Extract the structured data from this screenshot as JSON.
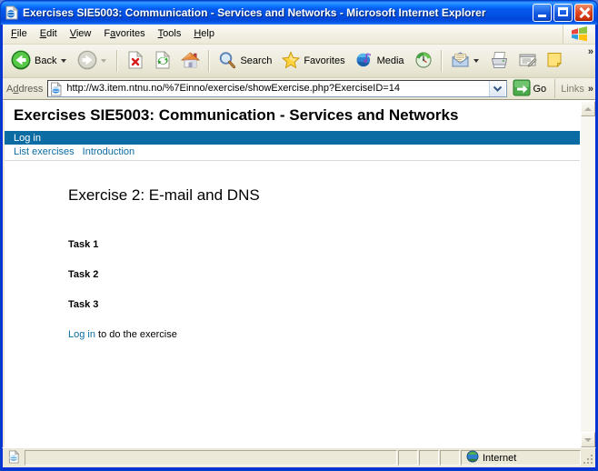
{
  "window": {
    "title": "Exercises SIE5003: Communication - Services and Networks - Microsoft Internet Explorer",
    "icon": "ie-document-icon",
    "buttons": {
      "minimize": "Minimize",
      "maximize": "Maximize",
      "close": "Close"
    }
  },
  "menubar": {
    "items": [
      {
        "label": "File",
        "accel": "F"
      },
      {
        "label": "Edit",
        "accel": "E"
      },
      {
        "label": "View",
        "accel": "V"
      },
      {
        "label": "Favorites",
        "accel": "a"
      },
      {
        "label": "Tools",
        "accel": "T"
      },
      {
        "label": "Help",
        "accel": "H"
      }
    ],
    "brand_icon": "windows-flag-icon"
  },
  "toolbar": {
    "back": {
      "label": "Back",
      "icon": "back-arrow-icon",
      "enabled": true
    },
    "forward": {
      "label": "",
      "icon": "forward-arrow-icon",
      "enabled": false
    },
    "stop": {
      "label": "",
      "icon": "stop-icon"
    },
    "refresh": {
      "label": "",
      "icon": "refresh-icon"
    },
    "home": {
      "label": "",
      "icon": "home-icon"
    },
    "search": {
      "label": "Search",
      "icon": "search-icon"
    },
    "favorites": {
      "label": "Favorites",
      "icon": "star-icon"
    },
    "media": {
      "label": "Media",
      "icon": "media-icon"
    },
    "history": {
      "label": "",
      "icon": "history-icon"
    },
    "mail": {
      "label": "",
      "icon": "mail-icon"
    },
    "print": {
      "label": "",
      "icon": "printer-icon"
    },
    "edit": {
      "label": "",
      "icon": "edit-icon"
    },
    "discuss": {
      "label": "",
      "icon": "note-icon"
    },
    "overflow": "»"
  },
  "address_bar": {
    "label": "Address",
    "url": "http://w3.item.ntnu.no/%7Einno/exercise/showExercise.php?ExerciseID=14",
    "placeholder": "",
    "favicon": "ie-page-icon",
    "dropdown_icon": "chevron-down-icon",
    "go_label": "Go",
    "go_icon": "go-arrow-icon",
    "links_label": "Links",
    "links_chevron": "»"
  },
  "page": {
    "site_title": "Exercises SIE5003: Communication - Services and Networks",
    "login_bar": {
      "label": "Log in"
    },
    "nav": [
      {
        "label": "List exercises"
      },
      {
        "label": "Introduction"
      }
    ],
    "heading": "Exercise 2: E-mail and DNS",
    "tasks": [
      {
        "label": "Task 1"
      },
      {
        "label": "Task 2"
      },
      {
        "label": "Task 3"
      }
    ],
    "login_prompt": {
      "link": "Log in",
      "rest": " to do the exercise"
    },
    "colors": {
      "bar": "#0b6ca3",
      "link": "#0b6ca3"
    }
  },
  "scrollbar": {
    "up_icon": "scroll-up-arrow-icon",
    "down_icon": "scroll-down-arrow-icon"
  },
  "statusbar": {
    "message": "",
    "zone": "Internet",
    "zone_icon": "globe-icon",
    "doc_icon": "ie-page-icon"
  }
}
